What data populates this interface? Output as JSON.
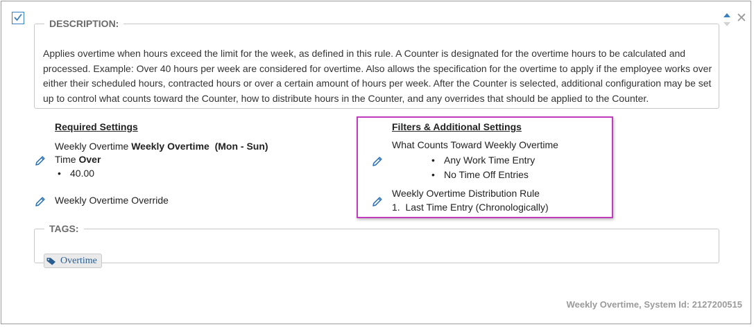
{
  "description": {
    "legend": "DESCRIPTION:",
    "text": "Applies overtime when hours exceed the limit for the week, as defined in this rule. A Counter is designated for the overtime hours to be calculated and processed. Example: Over 40 hours per week are considered for overtime. Also allows the specification for the overtime to apply if the employee works over either their scheduled hours, contracted hours or over a certain amount of hours per week. After the Counter is selected, additional configuration may be set up to control what counts toward the Counter, how to distribute hours in the Counter, and any overrides that should be applied to the Counter."
  },
  "required": {
    "header": "Required Settings",
    "line1_prefix": "Weekly Overtime ",
    "line1_bold": "Weekly Overtime  (Mon - Sun)",
    "line2_prefix": "Time ",
    "line2_bold": "Over",
    "value_bullet": "•",
    "value": "40.00",
    "override": "Weekly Overtime Override"
  },
  "filters": {
    "header": "Filters & Additional Settings",
    "counts_title": "What Counts Toward Weekly Overtime",
    "bullet_char": "•",
    "counts_items": [
      "Any Work Time Entry",
      "No Time Off Entries"
    ],
    "distribution_title": "Weekly Overtime Distribution Rule",
    "distribution_item": "1.  Last Time Entry (Chronologically)"
  },
  "tags": {
    "legend": "TAGS:",
    "items": [
      "Overtime"
    ]
  },
  "footer": "Weekly Overtime, System Id: 2127200515",
  "colors": {
    "accent": "#3a7fc1",
    "highlight_border": "#c13bbf",
    "muted_text": "#9a9a9a"
  },
  "icons": {
    "checkbox": "checkbox-checked-icon",
    "sort": "sort-arrows-icon",
    "close": "close-icon",
    "edit": "pencil-icon",
    "tag": "tag-icon"
  }
}
